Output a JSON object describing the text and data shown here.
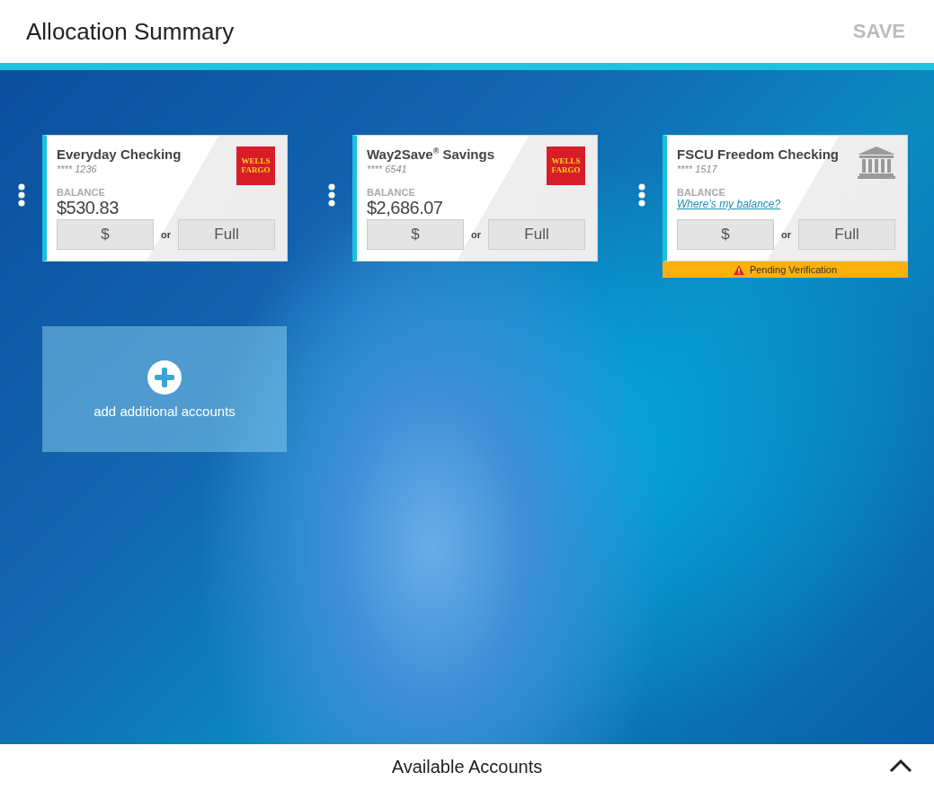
{
  "header": {
    "title": "Allocation Summary",
    "save": "SAVE"
  },
  "accounts": [
    {
      "name": "Everyday Checking",
      "number": "**** 1236",
      "balance_label": "BALANCE",
      "balance": {
        "kind": "amount",
        "text": "$530.83"
      },
      "logo": {
        "kind": "text",
        "lines": [
          "WELLS",
          "FARGO"
        ]
      },
      "amount_button": "$",
      "or": "or",
      "full_button": "Full"
    },
    {
      "name": "Way2Save$^{®}$ Savings",
      "number": "**** 6541",
      "balance_label": "BALANCE",
      "balance": {
        "kind": "amount",
        "text": "$2,686.07"
      },
      "logo": {
        "kind": "text",
        "lines": [
          "WELLS",
          "FARGO"
        ]
      },
      "amount_button": "$",
      "or": "or",
      "full_button": "Full"
    },
    {
      "name": "FSCU Freedom Checking",
      "number": "**** 1517",
      "balance_label": "BALANCE",
      "balance": {
        "kind": "link",
        "text": "Where’s my balance?"
      },
      "logo": {
        "kind": "bank"
      },
      "amount_button": "$",
      "or": "or",
      "full_button": "Full",
      "status": "Pending Verification"
    }
  ],
  "add_tile": {
    "label": "add additional accounts"
  },
  "footer": {
    "title": "Available Accounts"
  }
}
